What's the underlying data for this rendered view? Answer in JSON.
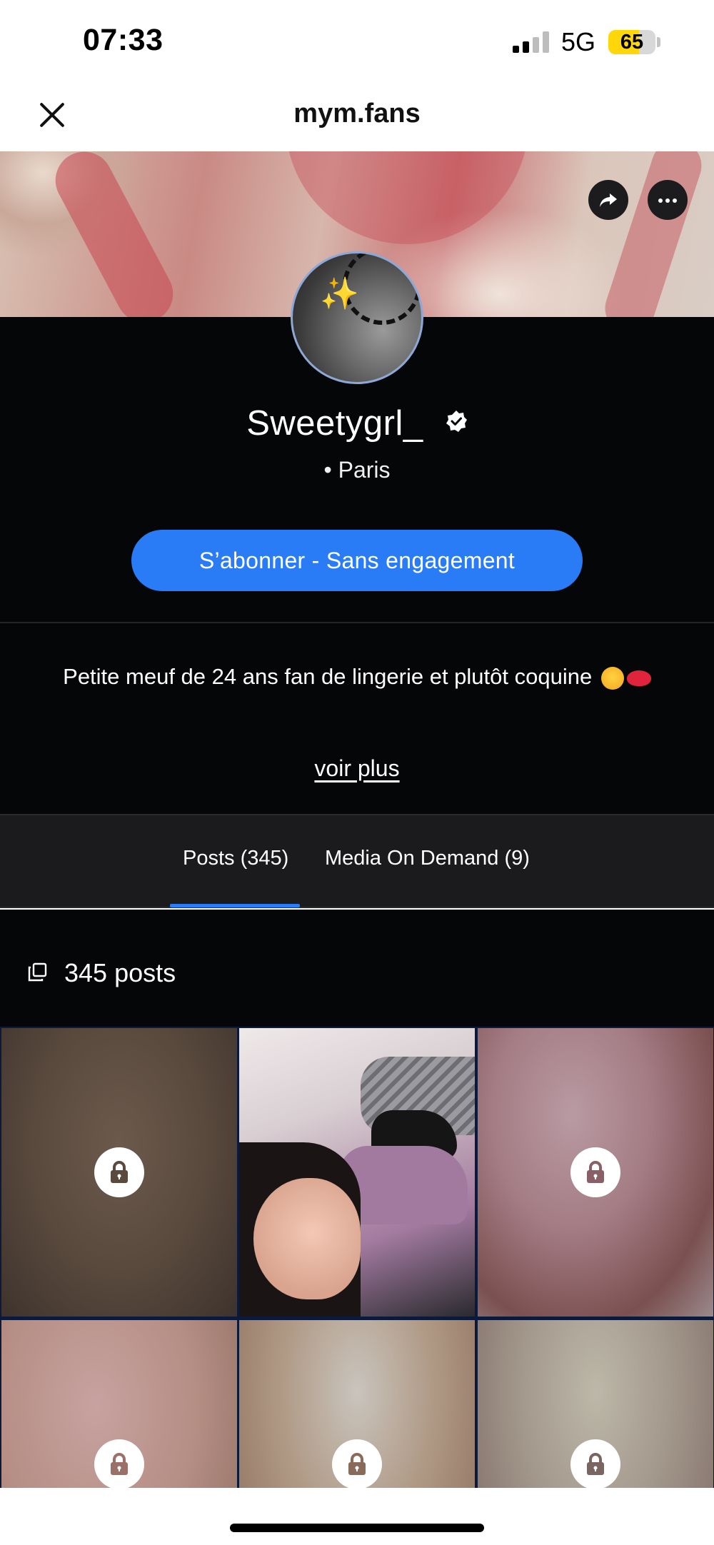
{
  "status_bar": {
    "time": "07:33",
    "network": "5G",
    "battery": "65",
    "battery_level": 0.65,
    "signal_bars": 2,
    "battery_color": "#ffd60a"
  },
  "nav": {
    "title": "mym.fans"
  },
  "profile": {
    "username": "Sweetygrl_",
    "verified": true,
    "location": "• Paris",
    "subscribe_label": "S’abonner - Sans engagement",
    "accent_color": "#2a7cf6"
  },
  "bio": {
    "text": "Petite meuf de 24 ans fan de lingerie et plutôt coquine",
    "emojis": [
      "smiling-face-with-hearts",
      "kiss-mark"
    ],
    "more_label": "voir plus"
  },
  "tabs": [
    {
      "label": "Posts (345)",
      "active": true
    },
    {
      "label": "Media On Demand (9)",
      "active": false
    }
  ],
  "posts": {
    "count_label": "345 posts",
    "tiles": [
      {
        "locked": true
      },
      {
        "locked": false
      },
      {
        "locked": true
      },
      {
        "locked": true
      },
      {
        "locked": true
      },
      {
        "locked": true
      }
    ]
  }
}
